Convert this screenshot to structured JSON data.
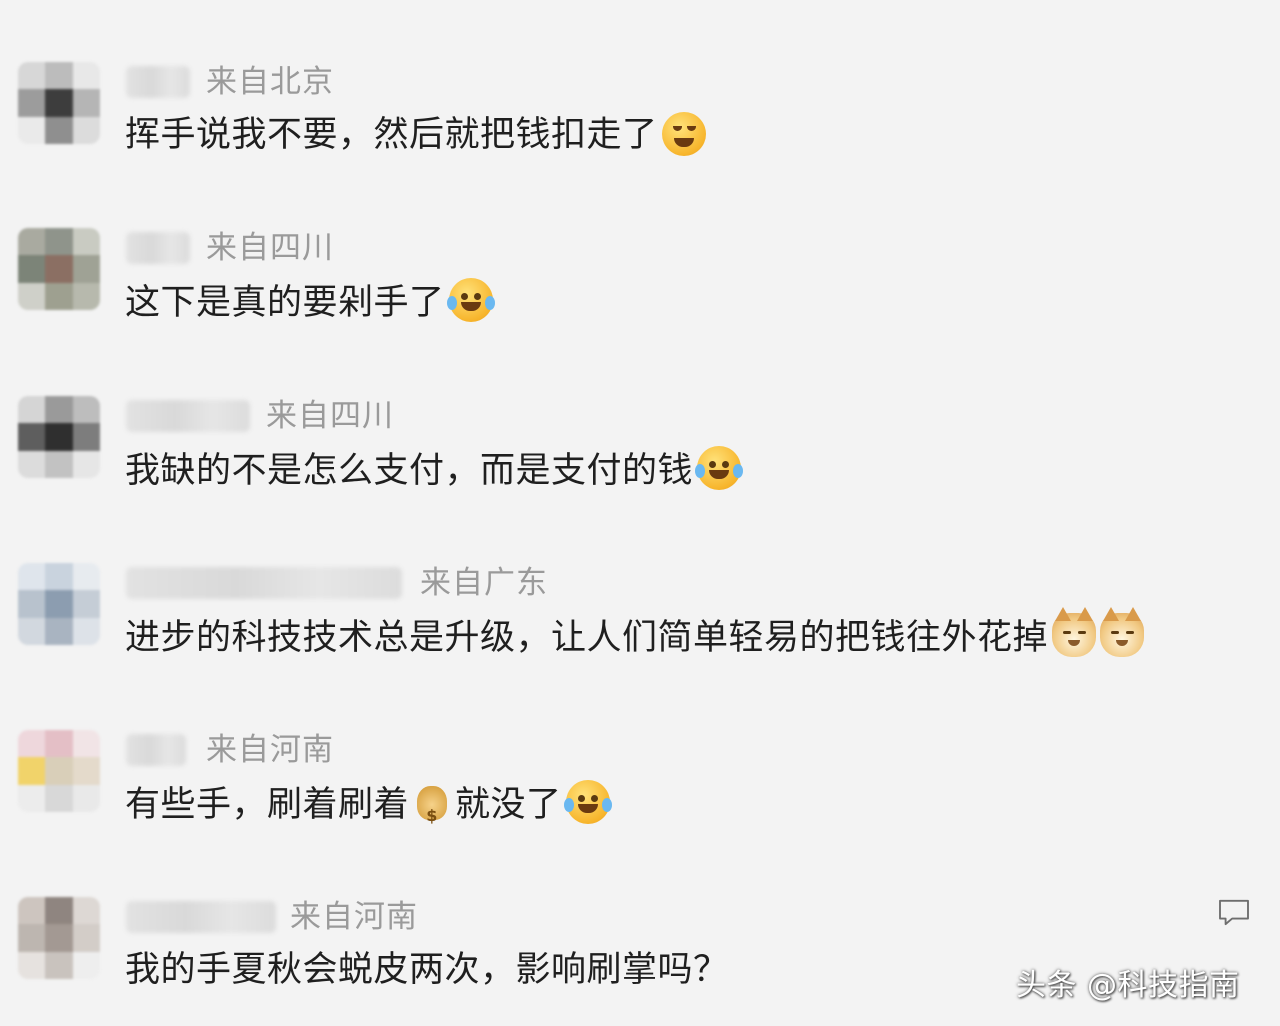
{
  "comments": [
    {
      "location": "来自北京",
      "text": "挥手说我不要，然后就把钱扣走了",
      "emoji": [
        "smile-icon"
      ],
      "avatar_colors": [
        "#d7d7d7",
        "#bcbcbc",
        "#e8e8e8",
        "#9c9c9c",
        "#3d3d3d",
        "#b5b5b5",
        "#eaeaea",
        "#8f8f8f",
        "#dcdcdc"
      ]
    },
    {
      "location": "来自四川",
      "text": "这下是真的要剁手了",
      "emoji": [
        "laugh-cry-icon"
      ],
      "avatar_colors": [
        "#a9aaa0",
        "#8f948b",
        "#c9cbc2",
        "#7c8478",
        "#8b6f63",
        "#9fa295",
        "#cfd0c9",
        "#9ea090",
        "#b7b9ad"
      ]
    },
    {
      "location": "来自四川",
      "text": "我缺的不是怎么支付，而是支付的钱",
      "emoji": [
        "laugh-cry-icon"
      ],
      "avatar_colors": [
        "#d5d5d5",
        "#9a9a9a",
        "#bdbdbd",
        "#5e5e5e",
        "#2f2f2f",
        "#7d7d7d",
        "#dcdcdc",
        "#c2c2c2",
        "#e6e6e6"
      ]
    },
    {
      "location": "来自广东",
      "text": "进步的科技技术总是升级，让人们简单轻易的把钱往外花掉",
      "emoji": [
        "doge-icon",
        "doge-icon"
      ],
      "avatar_colors": [
        "#dfe5ec",
        "#c9d3de",
        "#e7ebef",
        "#b8c2cd",
        "#8c9db0",
        "#c5cdd6",
        "#d2d8df",
        "#a9b4c1",
        "#dde2e8"
      ]
    },
    {
      "location": "来自河南",
      "text": "有些手，刷着刷着",
      "text2": "就没了",
      "emoji": [
        "money-bag-icon",
        "laugh-cry-icon"
      ],
      "avatar_colors": [
        "#eed7dc",
        "#e4bfc6",
        "#f1e4e6",
        "#f1d36a",
        "#d9cfb9",
        "#e4dacb",
        "#ececec",
        "#d8d8d8",
        "#e9e9e9"
      ]
    },
    {
      "location": "来自河南",
      "text": "我的手夏秋会蜕皮两次，影响刷掌吗？",
      "emoji": [],
      "avatar_colors": [
        "#cdc5bf",
        "#8f8580",
        "#ddd8d4",
        "#bdb6b0",
        "#a39993",
        "#d3cdc8",
        "#e6e2df",
        "#c9c3be",
        "#eeeeee"
      ]
    }
  ],
  "watermark": "头条 @科技指南"
}
